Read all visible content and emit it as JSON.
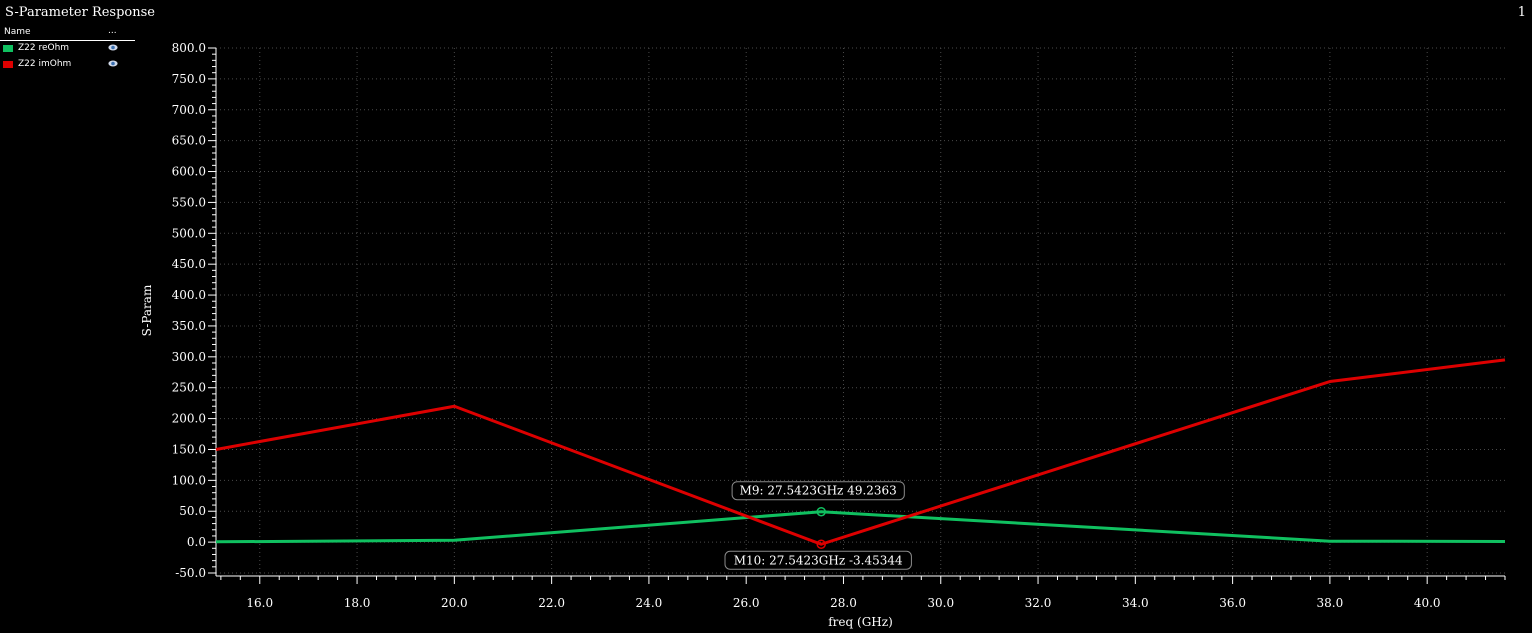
{
  "title": "S-Parameter Response",
  "page_number": "1",
  "legend": {
    "col_name": "Name",
    "col_dots": "...",
    "items": [
      {
        "label": "Z22 reOhm",
        "color": "#10c060",
        "icon": "eye-icon"
      },
      {
        "label": "Z22 imOhm",
        "color": "#dd0000",
        "icon": "eye-icon"
      }
    ]
  },
  "chart_data": {
    "type": "line",
    "xlabel": "freq (GHz)",
    "ylabel": "S-Param",
    "xlim": [
      15.1,
      41.6
    ],
    "ylim": [
      -50,
      800
    ],
    "xticks": [
      16,
      18,
      20,
      22,
      24,
      26,
      28,
      30,
      32,
      34,
      36,
      38,
      40
    ],
    "xtick_labels": [
      "16.0",
      "18.0",
      "20.0",
      "22.0",
      "24.0",
      "26.0",
      "28.0",
      "30.0",
      "32.0",
      "34.0",
      "36.0",
      "38.0",
      "40.0"
    ],
    "yticks": [
      -50,
      0,
      50,
      100,
      150,
      200,
      250,
      300,
      350,
      400,
      450,
      500,
      550,
      600,
      650,
      700,
      750,
      800
    ],
    "ytick_labels": [
      "-50.0",
      "0.0",
      "50.0",
      "100.0",
      "150.0",
      "200.0",
      "250.0",
      "300.0",
      "350.0",
      "400.0",
      "450.0",
      "500.0",
      "550.0",
      "600.0",
      "650.0",
      "700.0",
      "750.0",
      "800.0"
    ],
    "grid": true,
    "series": [
      {
        "name": "Z22 reOhm",
        "color": "#10c060",
        "x": [
          15.1,
          20.0,
          27.5423,
          38.0,
          41.6
        ],
        "y": [
          0.5,
          3.0,
          49.2363,
          1.5,
          1.0
        ]
      },
      {
        "name": "Z22 imOhm",
        "color": "#dd0000",
        "x": [
          15.1,
          20.0,
          27.5423,
          38.0,
          41.6
        ],
        "y": [
          150.0,
          220.0,
          -3.45344,
          260.0,
          295.0
        ]
      }
    ],
    "markers": [
      {
        "label": "M9: 27.5423GHz 49.2363",
        "x": 27.5423,
        "y": 49.2363,
        "color": "#10c060",
        "placement": "above"
      },
      {
        "label": "M10: 27.5423GHz -3.45344",
        "x": 27.5423,
        "y": -3.45344,
        "color": "#dd0000",
        "placement": "below"
      }
    ]
  }
}
